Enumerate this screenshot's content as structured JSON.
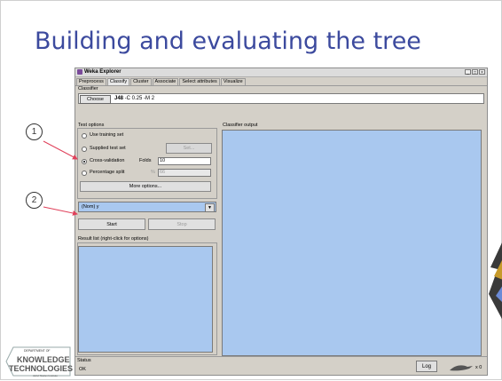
{
  "slide": {
    "title": "Building and evaluating the tree"
  },
  "window": {
    "title": "Weka Explorer",
    "controls": [
      "_",
      "□",
      "×"
    ]
  },
  "tabs": [
    {
      "label": "Preprocess",
      "active": false
    },
    {
      "label": "Classify",
      "active": true
    },
    {
      "label": "Cluster",
      "active": false
    },
    {
      "label": "Associate",
      "active": false
    },
    {
      "label": "Select attributes",
      "active": false
    },
    {
      "label": "Visualize",
      "active": false
    }
  ],
  "classifier": {
    "group_label": "Classifier",
    "choose_label": "Choose",
    "name": "J48",
    "params": " -C 0.25 -M 2"
  },
  "test_options": {
    "group_label": "Test options",
    "use_training_set": "Use training set",
    "supplied_test_set": "Supplied test set",
    "set_button": "Set...",
    "cross_validation": "Cross-validation",
    "folds_label": "Folds",
    "folds_value": "10",
    "percentage_split": "Percentage split",
    "percent_label": "%",
    "percent_value": "66",
    "more_options": "More options...",
    "selected": "cross_validation"
  },
  "class_attr": "(Nom) y",
  "start_label": "Start",
  "stop_label": "Stop",
  "result_list_label": "Result list (right-click for options)",
  "output_label": "Classifier output",
  "status": {
    "label": "Status",
    "text": "OK",
    "log_label": "Log",
    "x_count": "x 0"
  },
  "callouts": [
    "1",
    "2"
  ],
  "logo": {
    "line1": "DEPARTMENT OF",
    "line2": "KNOWLEDGE",
    "line3": "TECHNOLOGIES",
    "line4": "Jožef Stefan Institute"
  },
  "colors": {
    "title": "#3c4a9e",
    "panel_blue": "#a9c8ef",
    "arrow": "#e0405a"
  }
}
